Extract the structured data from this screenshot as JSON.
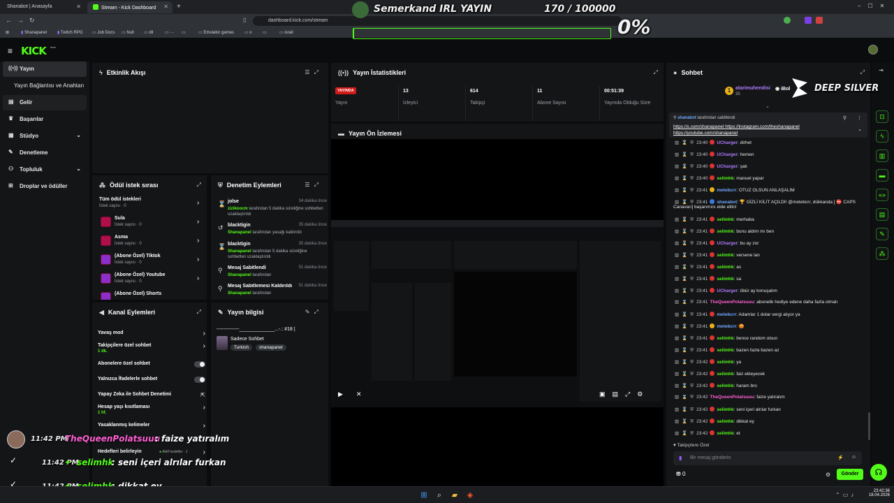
{
  "browser": {
    "tabs": [
      {
        "label": "Shanabot | Anasayfa",
        "active": false
      },
      {
        "label": "Stream - Kick Dashboard",
        "active": true
      }
    ],
    "new_tab": "+",
    "url": "dashboard.kick.com/stream",
    "bookmarks": [
      "Shanapanel",
      "Twitch RPG",
      "Job Docs",
      "Null",
      "dil",
      "···",
      "",
      "Emulator games",
      "x",
      "",
      "israil"
    ]
  },
  "overlay": {
    "stream_title": "Semerkand IRL YAYIN",
    "follower_goal": "170 / 100000",
    "goal_percent": "0%",
    "sponsor": "DEEP SILVER",
    "chat": [
      {
        "time": "11:42 PM",
        "user": "TheQueenPolatsuuu",
        "text": " : faize yatıralım",
        "color": "#ff5fd2"
      },
      {
        "time": "11:42 PM",
        "user": "selimhk",
        "text": " : seni içeri alrılar furkan",
        "color": "#53fc18"
      },
      {
        "time": "11:42 PM",
        "user": "selimhk",
        "text": " : dikkat ey",
        "color": "#53fc18"
      }
    ]
  },
  "kick": {
    "logo": "KICK",
    "logo_badge": "beta"
  },
  "sidebar": {
    "items": [
      {
        "label": "Yayın",
        "icon": "broadcast-icon",
        "active": true
      },
      {
        "label": "Yayın Bağlantısı ve Anahtarı",
        "icon": "",
        "active": false
      },
      {
        "label": "Gelir",
        "icon": "money-icon",
        "active": false
      },
      {
        "label": "Başarılar",
        "icon": "trophy-icon",
        "active": false
      },
      {
        "label": "Stüdyo",
        "icon": "studio-icon",
        "active": false
      },
      {
        "label": "Denetleme",
        "icon": "wrench-icon",
        "active": false
      },
      {
        "label": "Topluluk",
        "icon": "community-icon",
        "active": false
      },
      {
        "label": "Droplar ve ödüller",
        "icon": "gift-icon",
        "active": false
      }
    ]
  },
  "activity_feed": {
    "title": "Etkinlik Akışı"
  },
  "reward_queue": {
    "title": "Ödül istek sırası",
    "all": {
      "name": "Tüm ödül istekleri",
      "sub": "İstek sayısı · 0"
    },
    "items": [
      {
        "name": "Sula",
        "sub": "İstek sayısı · 0",
        "color": "red"
      },
      {
        "name": "Asma",
        "sub": "İstek sayısı · 0",
        "color": "red"
      },
      {
        "name": "(Abone Özel) Tiktok",
        "sub": "İstek sayısı · 0",
        "color": "purple"
      },
      {
        "name": "(Abone Özel) Youtube",
        "sub": "İstek sayısı · 0",
        "color": "purple"
      },
      {
        "name": "(Abone Özel) Shorts",
        "sub": "",
        "color": "purple"
      }
    ]
  },
  "mod_actions": {
    "title": "Denetim Eylemleri",
    "items": [
      {
        "icon": "hourglass-icon",
        "title": "jolse",
        "time": "34 dakika önce",
        "actor": "zizikoocm",
        "desc": " tarafından 5 dakika süreliğine sohbetten uzaklaştırıldı"
      },
      {
        "icon": "unban-icon",
        "title": "blacktigin",
        "time": "35 dakika önce",
        "actor": "Shanapanel",
        "desc": " tarafından yasağı kaldırıldı"
      },
      {
        "icon": "hourglass-icon",
        "title": "blacktigin",
        "time": "35 dakika önce",
        "actor": "Shanapanel",
        "desc": " tarafından 5 dakika süreliğine sohbetten uzaklaştırıldı"
      },
      {
        "icon": "pin-icon",
        "title": "Mesaj Sabitlendi",
        "time": "51 dakika önce",
        "actor": "Shanapanel",
        "desc": " tarafından"
      },
      {
        "icon": "unpin-icon",
        "title": "Mesaj Sabitlemesi Kaldırıldı",
        "time": "51 dakika önce",
        "actor": "Shanapanel",
        "desc": " tarafından"
      }
    ]
  },
  "channel_actions": {
    "title": "Kanal Eylemleri",
    "items": [
      {
        "title": "Yavaş mod",
        "sub": "",
        "control": "arrow"
      },
      {
        "title": "Takipçilere özel sohbet",
        "sub": "1 dk.",
        "control": "arrow"
      },
      {
        "title": "Abonelere özel sohbet",
        "sub": "",
        "control": "toggle"
      },
      {
        "title": "Yalnızca İfadelerle sohbet",
        "sub": "",
        "control": "toggle"
      },
      {
        "title": "Yapay Zeka ile Sohbet Denetimi",
        "sub": "",
        "control": "external"
      },
      {
        "title": "Hesap yaşı kısıtlaması",
        "sub": "1 hf.",
        "control": "arrow"
      },
      {
        "title": "Yasaklanmış kelimeler",
        "sub": "",
        "control": "arrow"
      },
      {
        "title": "Hedefleri belirleyin",
        "sub": "",
        "control": "arrow",
        "extra": "Aktif hedefler · 1"
      }
    ]
  },
  "stream_info": {
    "title": "Yayın bilgisi",
    "stream_title": "--------------_____________...-.: #18 |",
    "category": "Sadece Sohbet",
    "tags": [
      "Turkish",
      "shanapanel"
    ]
  },
  "stats": {
    "title": "Yayın İstatistikleri",
    "live_badge": "YAYINDA",
    "items": [
      {
        "value": "",
        "label": "Yayın"
      },
      {
        "value": "13",
        "label": "İzleyici"
      },
      {
        "value": "614",
        "label": "Takipçi"
      },
      {
        "value": "11",
        "label": "Abone Sayısı"
      },
      {
        "value": "00:51:39",
        "label": "Yayında Olduğu Süre"
      }
    ]
  },
  "preview": {
    "title": "Yayın Ön İzlemesi"
  },
  "chat": {
    "title": "Sohbet",
    "top_user": "atarimuhendisi",
    "top_amount": "35",
    "top_user2": "iBol",
    "pinned_by_user": "shanabot",
    "pinned_by_text": " tarafından sabitlendi",
    "pinned_text": "https://x.com/shanapanel https://instagram.com/theshanapanel https://youtube.com/shanapanel",
    "messages": [
      {
        "time": "23:40",
        "user": "UCharger",
        "cls": "u-purple",
        "badge": "r",
        "text": ": dirhet"
      },
      {
        "time": "23:40",
        "user": "UCharger",
        "cls": "u-purple",
        "badge": "r",
        "text": ": hemen"
      },
      {
        "time": "23:40",
        "user": "UCharger",
        "cls": "u-purple",
        "badge": "r",
        "text": ": şak"
      },
      {
        "time": "23:40",
        "user": "selimhk",
        "cls": "u-green",
        "badge": "r",
        "text": ": manuel yapar"
      },
      {
        "time": "23:41",
        "user": "metebcrr",
        "cls": "u-blue",
        "badge": "y",
        "text": ": OTUZ OLSUN ANLAŞALIM"
      },
      {
        "time": "23:41",
        "user": "shanabot",
        "cls": "u-blue",
        "badge": "b",
        "text": ": 🏆 GİZLİ KİLİT AÇILDI! @metebcrr, dükkanda [ ⛔ CAPS"
      },
      {
        "time": "",
        "user": "",
        "cls": "",
        "badge": "",
        "text": "Canavarı] başarımını elde ettin!"
      },
      {
        "time": "23:41",
        "user": "selimhk",
        "cls": "u-green",
        "badge": "r",
        "text": ": merhaba"
      },
      {
        "time": "23:41",
        "user": "selimhk",
        "cls": "u-green",
        "badge": "r",
        "text": ": bunu aldım mı ben"
      },
      {
        "time": "23:41",
        "user": "UCharger",
        "cls": "u-purple",
        "badge": "r",
        "text": ": bu ay zor"
      },
      {
        "time": "23:41",
        "user": "selimhk",
        "cls": "u-green",
        "badge": "r",
        "text": ": versene lan"
      },
      {
        "time": "23:41",
        "user": "selimhk",
        "cls": "u-green",
        "badge": "r",
        "text": ": as"
      },
      {
        "time": "23:41",
        "user": "selimhk",
        "cls": "u-green",
        "badge": "r",
        "text": ": sa"
      },
      {
        "time": "23:41",
        "user": "UCharger",
        "cls": "u-purple",
        "badge": "r",
        "text": ": öbür ay konuşalım"
      },
      {
        "time": "23:41",
        "user": "TheQueenPolatsuuu",
        "cls": "u-pink",
        "badge": "",
        "text": ": abonelik hediye edene daha fazla olmalı"
      },
      {
        "time": "23:41",
        "user": "metebcrr",
        "cls": "u-blue",
        "badge": "r",
        "text": ": Adamlar 1 dolar vergi alıyor ya"
      },
      {
        "time": "23:41",
        "user": "metebcrr",
        "cls": "u-blue",
        "badge": "y",
        "text": ": 😡"
      },
      {
        "time": "23:41",
        "user": "selimhk",
        "cls": "u-green",
        "badge": "r",
        "text": ": bence random olsun"
      },
      {
        "time": "23:41",
        "user": "selimhk",
        "cls": "u-green",
        "badge": "r",
        "text": ": bazen fazla bazen az"
      },
      {
        "time": "23:42",
        "user": "selimhk",
        "cls": "u-green",
        "badge": "r",
        "text": ": ya"
      },
      {
        "time": "23:42",
        "user": "selimhk",
        "cls": "u-green",
        "badge": "r",
        "text": ": faiz ekleyecek"
      },
      {
        "time": "23:42",
        "user": "selimhk",
        "cls": "u-green",
        "badge": "r",
        "text": ": haram bro"
      },
      {
        "time": "23:42",
        "user": "TheQueenPolatsuuu",
        "cls": "u-pink",
        "badge": "",
        "text": ": faize yatıralım"
      },
      {
        "time": "23:42",
        "user": "selimhk",
        "cls": "u-green",
        "badge": "r",
        "text": ": seni içeri alrılar furkan"
      },
      {
        "time": "23:42",
        "user": "selimhk",
        "cls": "u-green",
        "badge": "r",
        "text": ": dikkat ey"
      },
      {
        "time": "23:42",
        "user": "selimhk",
        "cls": "u-green",
        "badge": "r",
        "text": ": et"
      }
    ],
    "followers_only": "Takipçilere Özel",
    "input_placeholder": "Bir mesaj gönderin",
    "points": "0",
    "send": "Gönder"
  },
  "taskbar": {
    "time": "23:42:36",
    "date": "18.04.2026"
  }
}
